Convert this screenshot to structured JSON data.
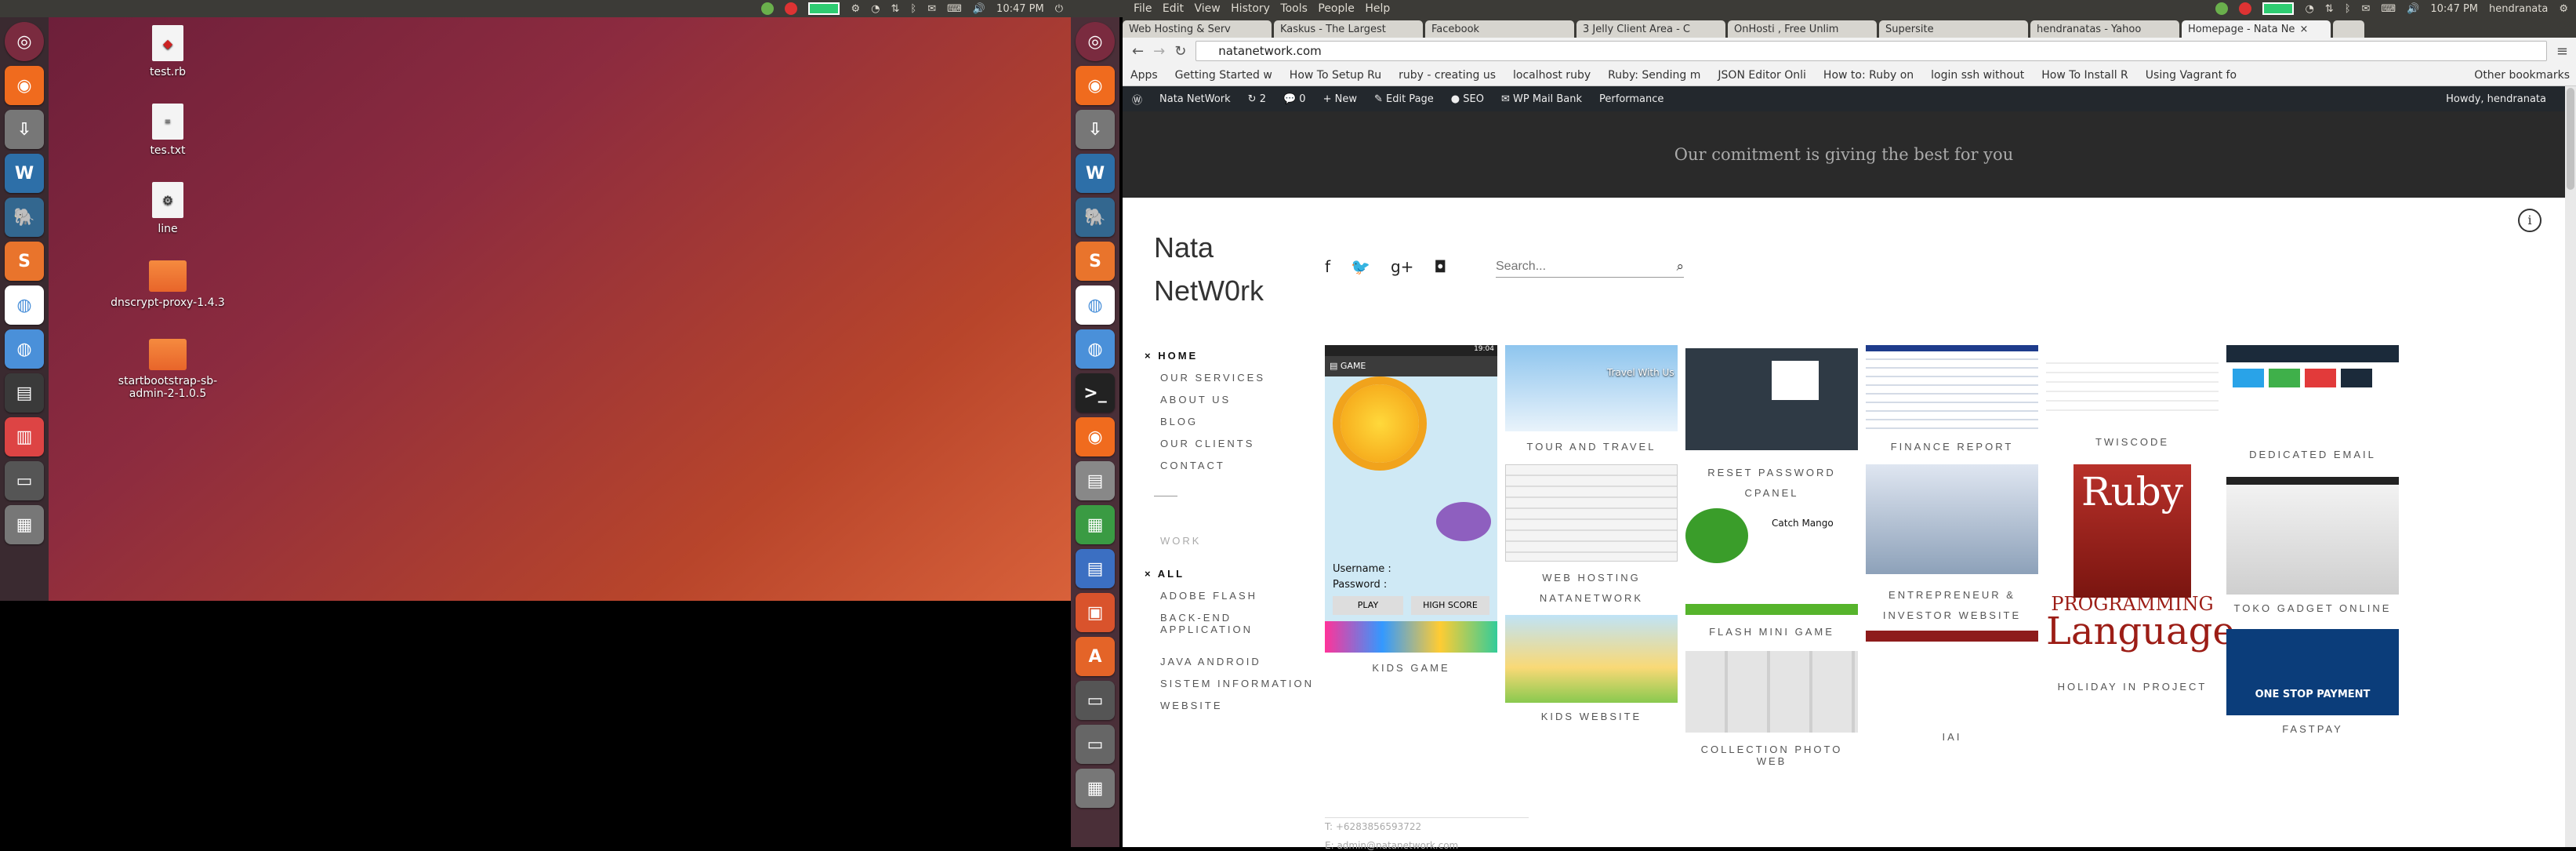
{
  "left_panel": {
    "menu": [
      "File",
      "Edit",
      "View",
      "History",
      "Tools",
      "People",
      "Help"
    ],
    "clock": "10:47 PM",
    "desktop_icons": [
      {
        "label": "test.rb"
      },
      {
        "label": "tes.txt"
      },
      {
        "label": "line"
      },
      {
        "label": "dnscrypt-proxy-1.4.3"
      },
      {
        "label": "startbootstrap-sb-admin-2-1.0.5"
      }
    ]
  },
  "right_panel": {
    "clock": "10:47 PM",
    "user": "hendranata",
    "tabs": [
      "Web Hosting & Serv",
      "Kaskus - The Largest",
      "Facebook",
      "3 Jelly Client Area - C",
      "OnHosti , Free Unlim",
      "Supersite",
      "hendranatas - Yahoo",
      "Homepage - Nata Ne"
    ],
    "url": "natanetwork.com",
    "bookmarks": [
      "Apps",
      "Getting Started w",
      "How To Setup Ru",
      "ruby - creating us",
      "localhost ruby",
      "Ruby: Sending m",
      "JSON Editor Onli",
      "How to: Ruby on",
      "login ssh without",
      "How To Install R",
      "Using Vagrant fo"
    ],
    "other_bookmarks": "Other bookmarks",
    "wp_admin": {
      "site": "Nata NetWork",
      "updates": "2",
      "comments": "0",
      "new": "New",
      "edit": "Edit Page",
      "seo": "SEO",
      "mailbank": "WP Mail Bank",
      "performance": "Performance",
      "howdy": "Howdy, hendranata"
    },
    "tagline": "Our comitment is giving the best for you",
    "site_title": "Nata NetW0rk",
    "search_placeholder": "Search...",
    "nav": [
      "HOME",
      "OUR SERVICES",
      "ABOUT US",
      "BLOG",
      "OUR CLIENTS",
      "CONTACT"
    ],
    "work_label": "WORK",
    "filters": [
      "ALL",
      "ADOBE FLASH",
      "BACK-END APPLICATION",
      "JAVA ANDROID",
      "SISTEM INFORMATION",
      "WEBSITE"
    ],
    "kids_game": {
      "username": "Username :",
      "password": "Password :",
      "play": "PLAY",
      "highscore": "HIGH SCORE",
      "title": "GAME",
      "time": "19:04"
    },
    "portfolio": [
      "KIDS GAME",
      "TOUR AND TRAVEL",
      "WEB HOSTING NATANETWORK",
      "KIDS WEBSITE",
      "RESET PASSWORD CPANEL",
      "FLASH MINI GAME",
      "COLLECTION PHOTO WEB",
      "FINANCE REPORT",
      "ENTREPRENEUR & INVESTOR WEBSITE",
      "IAI",
      "TWISCODE",
      "HOLIDAY IN PROJECT",
      "DEDICATED EMAIL",
      "TOKO GADGET ONLINE",
      "FASTPAY"
    ],
    "ruby_text": "Ruby",
    "ruby_sub": "PROGRAMMING",
    "ruby_sub2": "Language",
    "travel_text": "Travel With Us",
    "catch_mango": "Catch Mango",
    "fastpay_text": "ONE STOP PAYMENT",
    "contact_phone": "T:  +6283856593722",
    "contact_email": "E:  admin@natanetwork.com"
  }
}
